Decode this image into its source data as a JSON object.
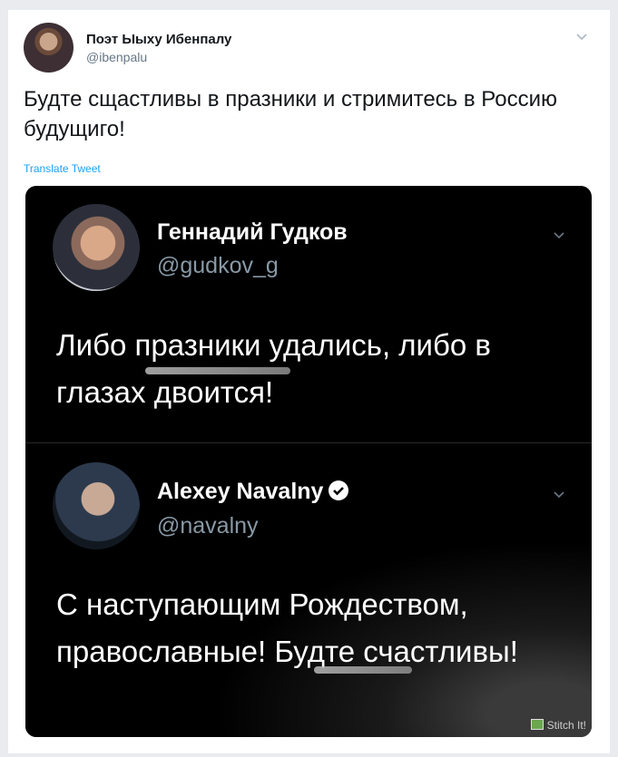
{
  "tweet": {
    "author_name": "Поэт Ыыху Ибенпалу",
    "author_handle": "@ibenpalu",
    "text": "Будте сщастливы в празники и стримитесь в Россию будущиго!",
    "translate_link": "Translate Tweet"
  },
  "embedded": [
    {
      "name": "Геннадий Гудков",
      "handle": "@gudkov_g",
      "text": "Либо празники удались, либо в глазах двоится!",
      "verified": false
    },
    {
      "name": "Alexey Navalny",
      "handle": "@navalny",
      "text": "С наступающим Рождеством, православные! Будте счастливы!",
      "verified": true
    }
  ],
  "watermark": "Stitch It!",
  "colors": {
    "link": "#1da1f2",
    "handle_dark": "#8899a6",
    "handle_light": "#657786"
  },
  "icons": {
    "caret": "chevron-down-icon",
    "verified": "verified-badge-icon"
  }
}
